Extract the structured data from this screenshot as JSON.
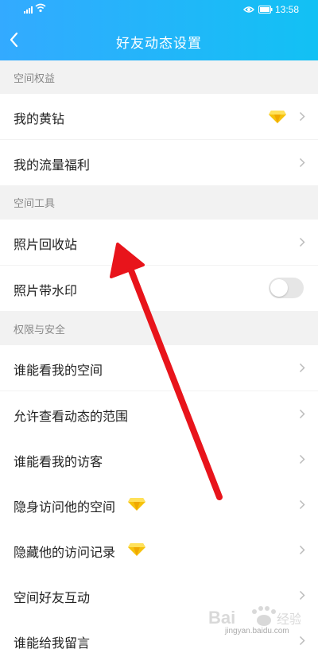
{
  "status": {
    "time": "13:58"
  },
  "header": {
    "title": "好友动态设置"
  },
  "sections": [
    {
      "title": "空间权益"
    },
    {
      "title": "空间工具"
    },
    {
      "title": "权限与安全"
    }
  ],
  "rows": [
    {
      "label": "我的黄钻",
      "badge": "diamond-icon"
    },
    {
      "label": "我的流量福利"
    },
    {
      "label": "照片回收站"
    },
    {
      "label": "照片带水印",
      "toggle": false
    },
    {
      "label": "谁能看我的空间"
    },
    {
      "label": "允许查看动态的范围"
    },
    {
      "label": "谁能看我的访客"
    },
    {
      "label": "隐身访问他的空间",
      "badge": "diamond-icon"
    },
    {
      "label": "隐藏他的访问记录",
      "badge": "diamond-icon"
    },
    {
      "label": "空间好友互动"
    },
    {
      "label": "谁能给我留言"
    }
  ],
  "watermark": {
    "text": "jingyan.baidu.com"
  },
  "colors": {
    "header_start": "#33aaff",
    "header_end": "#12c1f4",
    "annotation_arrow": "#e8141b",
    "diamond": "#f6c20c"
  }
}
